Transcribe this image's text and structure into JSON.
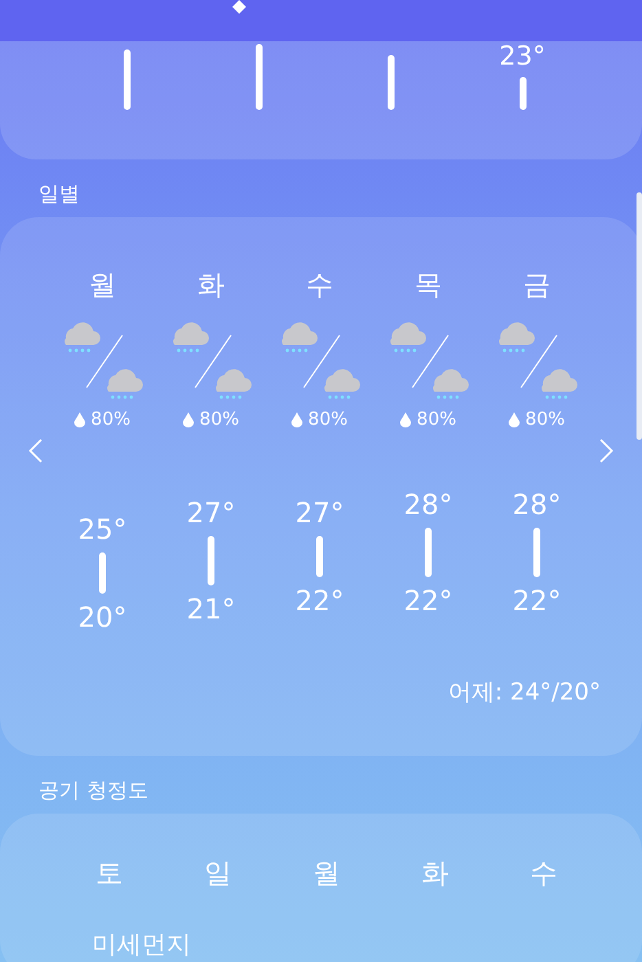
{
  "top_card": {
    "reading": "23°"
  },
  "daily": {
    "title": "일별",
    "days": [
      {
        "day": "월",
        "precip": "80%",
        "high": "25°",
        "low": "20°"
      },
      {
        "day": "화",
        "precip": "80%",
        "high": "27°",
        "low": "21°"
      },
      {
        "day": "수",
        "precip": "80%",
        "high": "27°",
        "low": "22°"
      },
      {
        "day": "목",
        "precip": "80%",
        "high": "28°",
        "low": "22°"
      },
      {
        "day": "금",
        "precip": "80%",
        "high": "28°",
        "low": "22°"
      }
    ],
    "yesterday": "어제: 24°/20°"
  },
  "air": {
    "title": "공기 청정도",
    "days": [
      "토",
      "일",
      "월",
      "화",
      "수"
    ],
    "row_label": "미세먼지"
  }
}
